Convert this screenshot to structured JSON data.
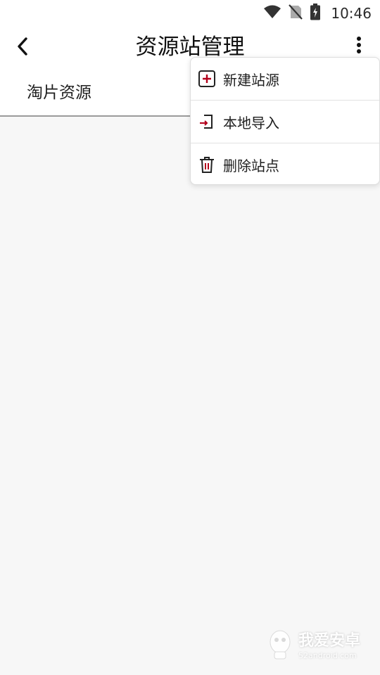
{
  "status_bar": {
    "time": "10:46",
    "icons": [
      "wifi-icon",
      "no-signal-icon",
      "battery-charging-icon"
    ]
  },
  "app_bar": {
    "title": "资源站管理",
    "back_icon": "back-arrow-icon",
    "more_icon": "more-vert-icon"
  },
  "source_list": [
    {
      "label": "淘片资源"
    }
  ],
  "popup_menu": {
    "items": [
      {
        "label": "新建站源",
        "icon": "add-square-icon"
      },
      {
        "label": "本地导入",
        "icon": "import-icon"
      },
      {
        "label": "删除站点",
        "icon": "trash-icon"
      }
    ]
  },
  "watermark": {
    "brand": "我爱安卓",
    "url": "52android.com"
  },
  "colors": {
    "accent_red": "#b3001b",
    "background": "#f7f7f7",
    "surface": "#ffffff"
  }
}
